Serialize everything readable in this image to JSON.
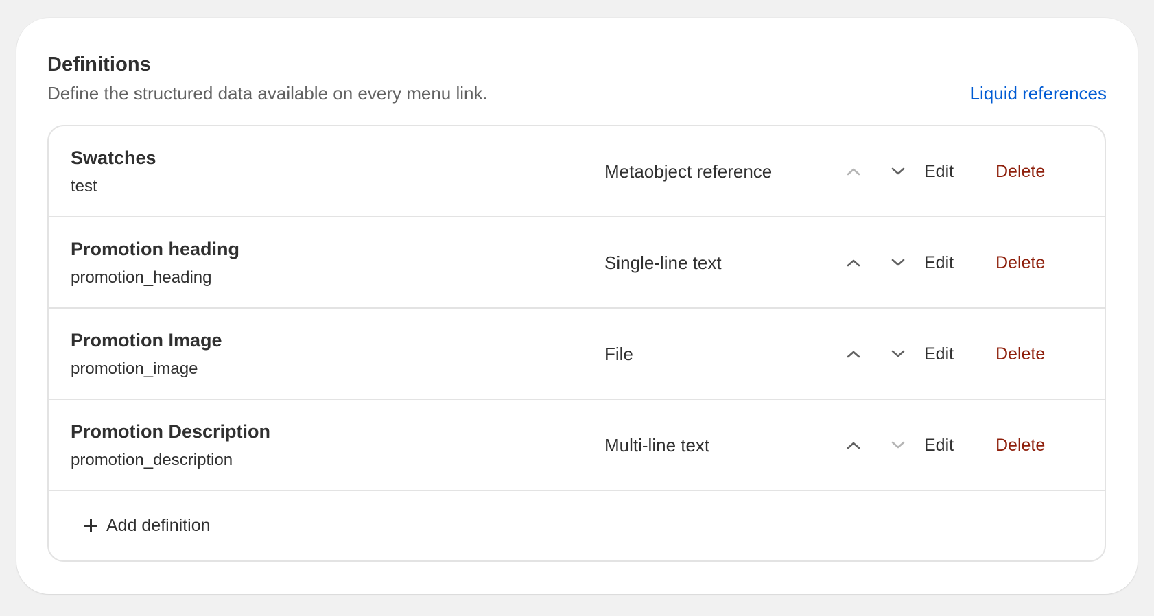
{
  "section": {
    "title": "Definitions",
    "subtitle": "Define the structured data available on every menu link.",
    "link_label": "Liquid references"
  },
  "definitions": [
    {
      "name": "Swatches",
      "key": "test",
      "type": "Metaobject reference",
      "move_up_enabled": false,
      "move_down_enabled": true,
      "edit_label": "Edit",
      "delete_label": "Delete"
    },
    {
      "name": "Promotion heading",
      "key": "promotion_heading",
      "type": "Single-line text",
      "move_up_enabled": true,
      "move_down_enabled": true,
      "edit_label": "Edit",
      "delete_label": "Delete"
    },
    {
      "name": "Promotion Image",
      "key": "promotion_image",
      "type": "File",
      "move_up_enabled": true,
      "move_down_enabled": true,
      "edit_label": "Edit",
      "delete_label": "Delete"
    },
    {
      "name": "Promotion Description",
      "key": "promotion_description",
      "type": "Multi-line text",
      "move_up_enabled": true,
      "move_down_enabled": false,
      "edit_label": "Edit",
      "delete_label": "Delete"
    }
  ],
  "add_definition_label": "Add definition",
  "icons": {
    "move_up": "chevron-up-icon",
    "move_down": "chevron-down-icon",
    "add": "plus-icon"
  },
  "colors": {
    "link": "#005bd3",
    "delete": "#8e1f0b",
    "text": "#303030",
    "subdued": "#616161",
    "border": "#e3e3e3"
  }
}
